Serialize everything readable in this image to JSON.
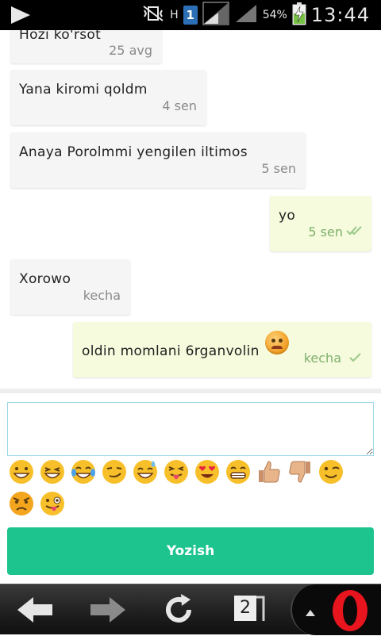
{
  "status_bar": {
    "network_type": "H",
    "sim_number": "1",
    "battery_percent": "54%",
    "time": "13:44"
  },
  "messages": [
    {
      "direction": "in",
      "text": "Hozi ko'rsot",
      "time": "25 avg"
    },
    {
      "direction": "in",
      "text": "Yana kiromi qoldm",
      "time": "4 sen"
    },
    {
      "direction": "in",
      "text": "Anaya Porolmmi yengilen iltimos",
      "time": "5 sen"
    },
    {
      "direction": "out",
      "text": "yo",
      "time": "5 sen",
      "status": "read"
    },
    {
      "direction": "in",
      "text": "Xorowo",
      "time": "kecha"
    },
    {
      "direction": "out",
      "text": "oldin momlani 6rganvolin",
      "time": "kecha",
      "status": "sent",
      "emoji": "angry-face-icon"
    }
  ],
  "composer": {
    "value": "",
    "placeholder": ""
  },
  "emoji_palette": [
    "grinning-face-icon",
    "laughing-face-icon",
    "tears-of-joy-face-icon",
    "smirking-face-icon",
    "sweat-smile-face-icon",
    "tongue-squint-face-icon",
    "heart-eyes-face-icon",
    "grimacing-face-icon",
    "thumbs-up-icon",
    "thumbs-down-icon",
    "winking-face-icon",
    "angry-face-icon",
    "zany-face-icon"
  ],
  "send_button": {
    "label": "Yozish"
  },
  "browser_bar": {
    "tab_count": "2"
  },
  "colors": {
    "accent": "#1dc48e",
    "outgoing_bubble": "#f5fbdc",
    "incoming_bubble": "#f5f5f5",
    "input_border": "#9fd8e6"
  }
}
